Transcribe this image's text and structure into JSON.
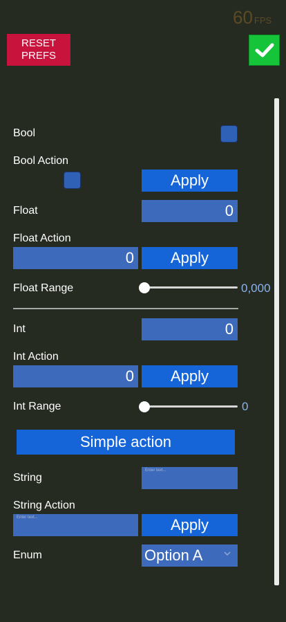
{
  "fps": {
    "value": "60",
    "unit": "FPS"
  },
  "header": {
    "reset_label": "RESET\nPREFS",
    "confirm_icon": "check-icon"
  },
  "colors": {
    "background": "#262b22",
    "accent": "#1565d8",
    "field": "#3e6abc",
    "reset": "#c8143c",
    "confirm": "#16c43a"
  },
  "rows": {
    "bool": {
      "label": "Bool"
    },
    "bool_action": {
      "label": "Bool Action",
      "button": "Apply"
    },
    "float": {
      "label": "Float",
      "value": "0"
    },
    "float_action": {
      "label": "Float Action",
      "value": "0",
      "button": "Apply"
    },
    "float_range": {
      "label": "Float Range",
      "value_text": "0,000",
      "fraction": 0
    },
    "int": {
      "label": "Int",
      "value": "0"
    },
    "int_action": {
      "label": "Int Action",
      "value": "0",
      "button": "Apply"
    },
    "int_range": {
      "label": "Int Range",
      "value_text": "0",
      "fraction": 0
    },
    "simple_action": {
      "button": "Simple action"
    },
    "string": {
      "label": "String",
      "placeholder": "Enter text..."
    },
    "string_action": {
      "label": "String Action",
      "placeholder": "Enter text...",
      "button": "Apply"
    },
    "enum": {
      "label": "Enum",
      "selected": "Option A"
    }
  }
}
